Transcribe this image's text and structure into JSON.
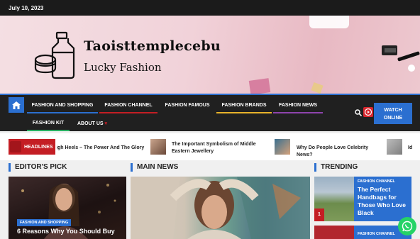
{
  "topbar": {
    "date": "July 10, 2023"
  },
  "header": {
    "site_title": "Taoisttemplecebu",
    "tagline": "Lucky Fashion"
  },
  "nav": {
    "row1": [
      {
        "label": "FASHION AND SHOPPING",
        "color": "#2b6fd0"
      },
      {
        "label": "FASHION CHANNEL",
        "color": "#c41e24"
      },
      {
        "label": "FASHION FAMOUS",
        "color": "#202020"
      },
      {
        "label": "FASHION BRANDS",
        "color": "#e8b32a"
      },
      {
        "label": "FASHION NEWS",
        "color": "#8e44ad"
      }
    ],
    "row2": [
      {
        "label": "FASHION KIT",
        "color": "#27ae60"
      },
      {
        "label": "ABOUT US",
        "color": "#202020"
      }
    ],
    "about_chevron": "▾",
    "watch_label_1": "WATCH",
    "watch_label_2": "ONLINE"
  },
  "ticker": {
    "label": "HEADLINES",
    "items": [
      "High Heels – The Power And The Glory",
      "The Important Symbolism of Middle Eastern Jewellery",
      "Why Do People Love Celebrity News?",
      "Id"
    ]
  },
  "sections": {
    "editors_pick": "EDITOR'S PICK",
    "main_news": "MAIN NEWS",
    "trending": "TRENDING"
  },
  "editors_pick": {
    "category": "FASHION AND SHOPPING",
    "title": "6 Reasons Why You Should Buy"
  },
  "trending": [
    {
      "rank": "1",
      "category": "FASHION CHANNEL",
      "title": "The Perfect Handbags for Those Who Love Black"
    },
    {
      "category": "FASHION CHANNEL"
    }
  ],
  "colors": {
    "accent": "#2b6fd0",
    "red": "#c41e24",
    "nav_bg": "#202020"
  }
}
